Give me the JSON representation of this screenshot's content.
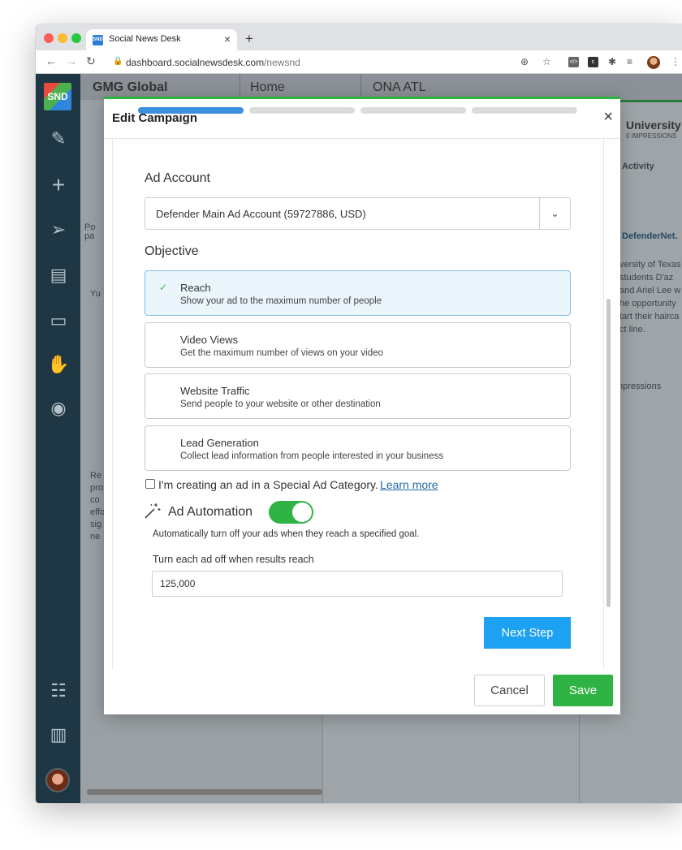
{
  "browser": {
    "tab_title": "Social News Desk",
    "tab_close": "×",
    "new_tab": "+",
    "url_domain": "dashboard.socialnewsdesk.com",
    "url_path": "/newsnd"
  },
  "app": {
    "logo": "SND",
    "columns": [
      "GMG Global",
      "Home",
      "ONA ATL"
    ],
    "right_column_title": "University",
    "right_column_sub": "0 IMPRESSIONS",
    "activity_label": "Activity",
    "defender_label": "DefenderNet.",
    "snippet": [
      "versity of Texas",
      " students D'az",
      "and Ariel Lee w",
      "he opportunity",
      "tart their hairca",
      "ct line."
    ],
    "impressions": "npressions",
    "left_snippets": [
      "Po",
      "pa",
      "Yu",
      "Re",
      "pro",
      "co",
      "effo",
      "sig",
      "ne"
    ]
  },
  "modal": {
    "title": "Edit Campaign",
    "close": "×",
    "steps": 4,
    "active_step": 1,
    "ad_account_label": "Ad Account",
    "ad_account_value": "Defender Main Ad Account (59727886, USD)",
    "objective_label": "Objective",
    "objectives": [
      {
        "title": "Reach",
        "desc": "Show your ad to the maximum number of people",
        "selected": true
      },
      {
        "title": "Video Views",
        "desc": "Get the maximum number of views on your video",
        "selected": false
      },
      {
        "title": "Website Traffic",
        "desc": "Send people to your website or other destination",
        "selected": false
      },
      {
        "title": "Lead Generation",
        "desc": "Collect lead information from people interested in your business",
        "selected": false
      }
    ],
    "special_category_label": "I'm creating an ad in a Special Ad Category.",
    "learn_more": "Learn more",
    "automation_label": "Ad Automation",
    "automation_enabled": true,
    "automation_desc": "Automatically turn off your ads when they reach a specified goal.",
    "turnoff_label": "Turn each ad off when results reach",
    "turnoff_value": "125,000",
    "next_step": "Next Step",
    "cancel": "Cancel",
    "save": "Save"
  },
  "colors": {
    "accent_green": "#2fb344",
    "accent_blue": "#1da1f2",
    "step_active": "#3b8fdc",
    "sidebar": "#1f3745"
  }
}
